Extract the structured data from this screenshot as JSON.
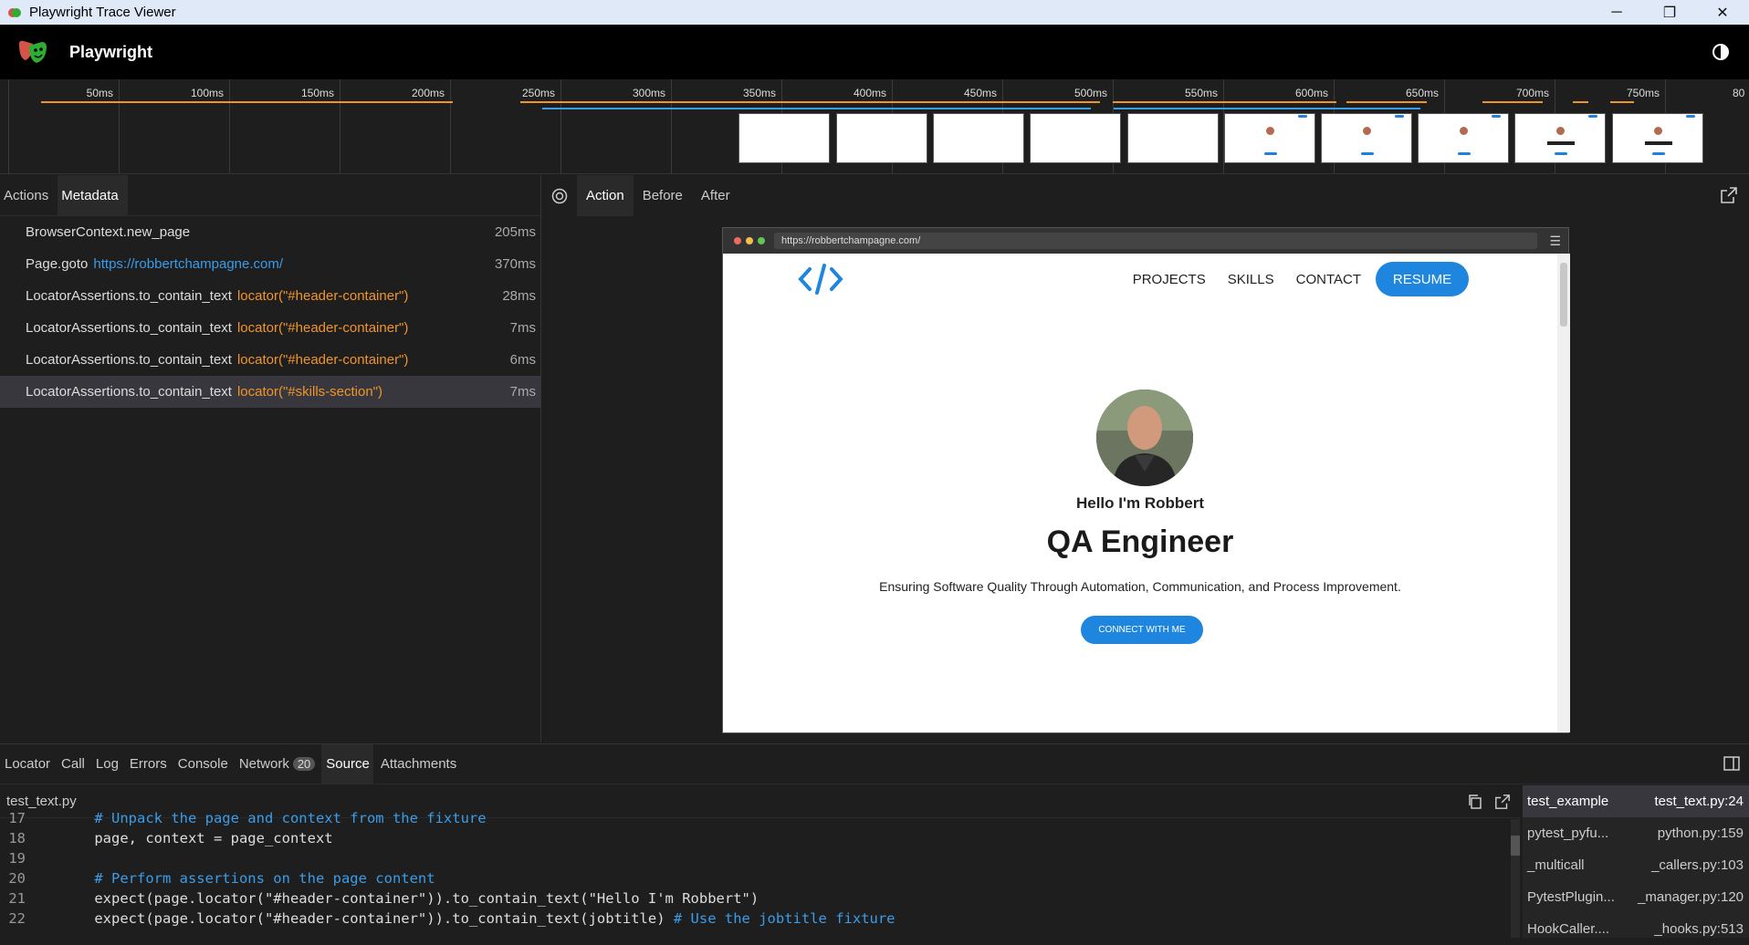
{
  "window": {
    "title": "Playwright Trace Viewer",
    "minimize": "─",
    "maximize": "❐",
    "close": "✕"
  },
  "header": {
    "app_name": "Playwright"
  },
  "timeline": {
    "ticks": [
      "50ms",
      "100ms",
      "150ms",
      "200ms",
      "250ms",
      "300ms",
      "350ms",
      "400ms",
      "450ms",
      "500ms",
      "550ms",
      "600ms",
      "650ms",
      "700ms",
      "750ms",
      "80"
    ]
  },
  "left_tabs": [
    "Actions",
    "Metadata"
  ],
  "actions": [
    {
      "name": "BrowserContext.new_page",
      "param": "",
      "param_type": "",
      "duration": "205ms"
    },
    {
      "name": "Page.goto",
      "param": "https://robbertchampagne.com/",
      "param_type": "url",
      "duration": "370ms"
    },
    {
      "name": "LocatorAssertions.to_contain_text",
      "param": "locator(\"#header-container\")",
      "param_type": "loc",
      "duration": "28ms"
    },
    {
      "name": "LocatorAssertions.to_contain_text",
      "param": "locator(\"#header-container\")",
      "param_type": "loc",
      "duration": "7ms"
    },
    {
      "name": "LocatorAssertions.to_contain_text",
      "param": "locator(\"#header-container\")",
      "param_type": "loc",
      "duration": "6ms"
    },
    {
      "name": "LocatorAssertions.to_contain_text",
      "param": "locator(\"#skills-section\")",
      "param_type": "loc",
      "duration": "7ms"
    }
  ],
  "snapshot_tabs": [
    "Action",
    "Before",
    "After"
  ],
  "browser": {
    "url": "https://robbertchampagne.com/"
  },
  "site": {
    "nav": [
      "PROJECTS",
      "SKILLS",
      "CONTACT"
    ],
    "resume": "RESUME",
    "hello": "Hello I'm Robbert",
    "job_title": "QA Engineer",
    "tagline": "Ensuring Software Quality Through Automation, Communication, and Process Improvement.",
    "connect": "CONNECT WITH ME"
  },
  "bottom_tabs": [
    {
      "label": "Locator",
      "count": ""
    },
    {
      "label": "Call",
      "count": ""
    },
    {
      "label": "Log",
      "count": ""
    },
    {
      "label": "Errors",
      "count": ""
    },
    {
      "label": "Console",
      "count": ""
    },
    {
      "label": "Network",
      "count": "20"
    },
    {
      "label": "Source",
      "count": ""
    },
    {
      "label": "Attachments",
      "count": ""
    }
  ],
  "source": {
    "file": "test_text.py",
    "lines": [
      {
        "num": "17",
        "text": "    # Unpack the page and context from the fixture",
        "kind": "comment"
      },
      {
        "num": "18",
        "text": "    page, context = page_context",
        "kind": "code"
      },
      {
        "num": "19",
        "text": "",
        "kind": "code"
      },
      {
        "num": "20",
        "text": "    # Perform assertions on the page content",
        "kind": "comment"
      },
      {
        "num": "21",
        "text": "    expect(page.locator(\"#header-container\")).to_contain_text(\"Hello I'm Robbert\")",
        "kind": "code"
      },
      {
        "num": "22",
        "text": "    expect(page.locator(\"#header-container\")).to_contain_text(jobtitle) ",
        "kind": "code",
        "comment": "# Use the jobtitle fixture"
      }
    ]
  },
  "stack": [
    {
      "name": "test_example",
      "file": "test_text.py:24"
    },
    {
      "name": "pytest_pyfu...",
      "file": "python.py:159"
    },
    {
      "name": "_multicall",
      "file": "_callers.py:103"
    },
    {
      "name": "PytestPlugin...",
      "file": "_manager.py:120"
    },
    {
      "name": "HookCaller....",
      "file": "_hooks.py:513"
    }
  ],
  "colors": {
    "accent_blue": "#1f86e0",
    "locator_orange": "#f0952b",
    "url_blue": "#3b9ce8"
  }
}
